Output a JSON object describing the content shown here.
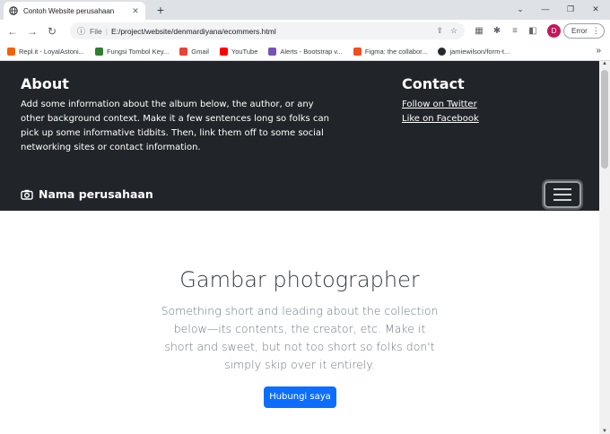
{
  "browser": {
    "tab_title": "Contoh Website perusahaan",
    "tab_close": "✕",
    "new_tab": "+",
    "win_minimize": "⌄",
    "win_min": "—",
    "win_restore": "❐",
    "win_close": "✕",
    "scheme": "File",
    "url": "E:/project/website/denmardiyana/ecommers.html",
    "profile_initial": "D",
    "error_label": "Error",
    "bookmarks": [
      {
        "label": "Repl.it - LoyalAstoni...",
        "color": "#f26207"
      },
      {
        "label": "Fungsi Tombol Key...",
        "color": "#2e7d32"
      },
      {
        "label": "Gmail",
        "color": "#ea4335"
      },
      {
        "label": "YouTube",
        "color": "#ff0000"
      },
      {
        "label": "Alerts - Bootstrap v...",
        "color": "#7952b3"
      },
      {
        "label": "Figma: the collabor...",
        "color": "#f24e1e"
      },
      {
        "label": "jamiewilson/form-t...",
        "color": "#24292e"
      }
    ],
    "more": "»"
  },
  "header": {
    "about_title": "About",
    "about_text": "Add some information about the album below, the author, or any other background context. Make it a few sentences long so folks can pick up some informative tidbits. Then, link them off to some social networking sites or contact information.",
    "contact_title": "Contact",
    "contact_links": [
      "Follow on Twitter",
      "Like on Facebook"
    ],
    "brand": "Nama perusahaan"
  },
  "hero": {
    "title": "Gambar photographer",
    "lead": "Something short and leading about the collection below—its contents, the creator, etc. Make it short and sweet, but not too short so folks don't simply skip over it entirely.",
    "button": "Hubungi saya"
  },
  "colors": {
    "navbar_bg": "#212529",
    "primary": "#0d6efd"
  }
}
